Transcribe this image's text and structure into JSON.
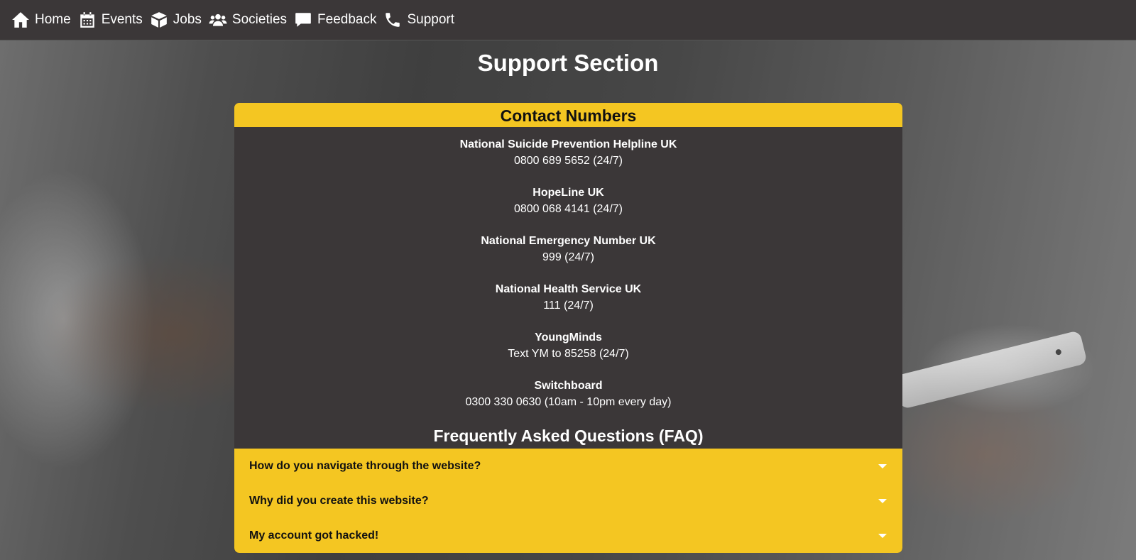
{
  "nav": {
    "items": [
      {
        "label": "Home",
        "icon": "home-icon"
      },
      {
        "label": "Events",
        "icon": "calendar-icon"
      },
      {
        "label": "Jobs",
        "icon": "box-icon"
      },
      {
        "label": "Societies",
        "icon": "users-icon"
      },
      {
        "label": "Feedback",
        "icon": "comment-icon"
      },
      {
        "label": "Support",
        "icon": "phone-icon"
      }
    ]
  },
  "page": {
    "title": "Support Section"
  },
  "contacts": {
    "header": "Contact Numbers",
    "items": [
      {
        "name": "National Suicide Prevention Helpline UK",
        "number": "0800 689 5652 (24/7)"
      },
      {
        "name": "HopeLine UK",
        "number": "0800 068 4141 (24/7)"
      },
      {
        "name": "National Emergency Number UK",
        "number": "999 (24/7)"
      },
      {
        "name": "National Health Service UK",
        "number": "111 (24/7)"
      },
      {
        "name": "YoungMinds",
        "number": "Text YM to 85258 (24/7)"
      },
      {
        "name": "Switchboard",
        "number": "0300 330 0630 (10am - 10pm every day)"
      }
    ]
  },
  "faq": {
    "title": "Frequently Asked Questions (FAQ)",
    "items": [
      {
        "question": "How do you navigate through the website?"
      },
      {
        "question": "Why did you create this website?"
      },
      {
        "question": "My account got hacked!"
      }
    ]
  },
  "colors": {
    "accent": "#f4c622",
    "panel": "#3b3738",
    "text": "#ffffff"
  }
}
